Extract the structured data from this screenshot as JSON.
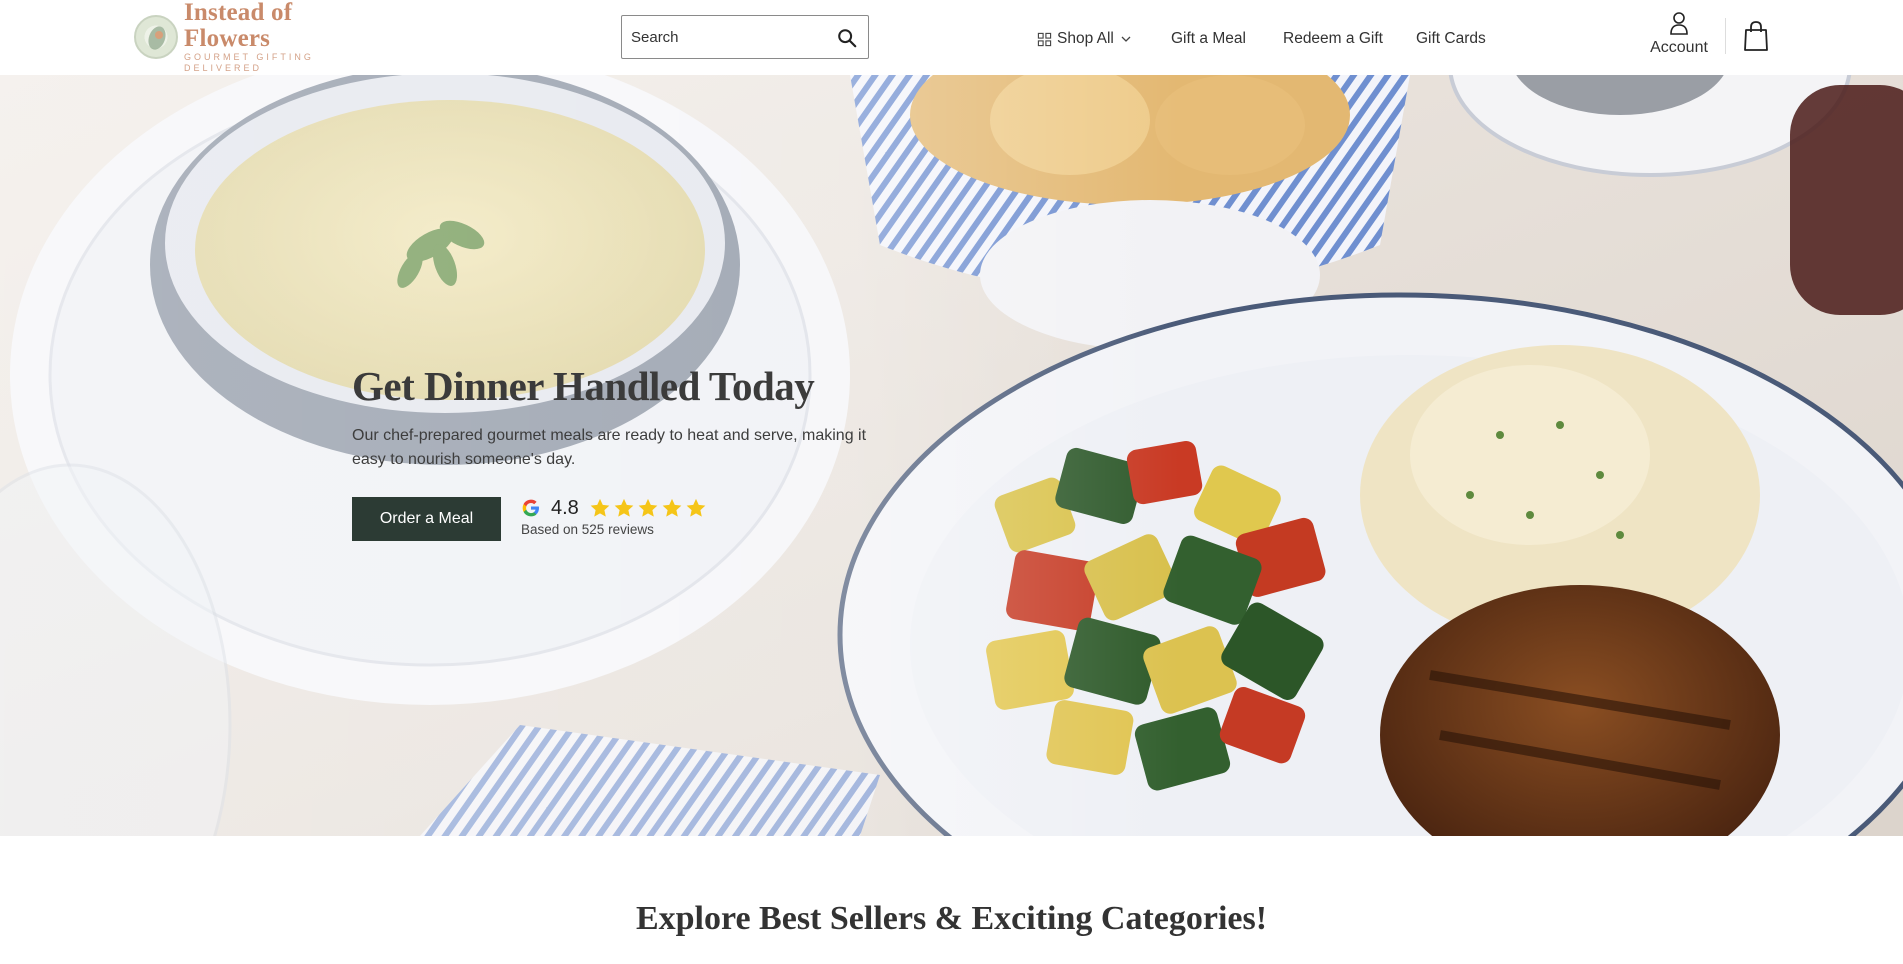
{
  "brand": {
    "name": "Instead of Flowers",
    "tagline": "GOURMET GIFTING DELIVERED",
    "color": "#c98a6a"
  },
  "search": {
    "placeholder": "Search",
    "icon": "search-icon"
  },
  "nav": {
    "items": [
      {
        "label": "Shop All",
        "icon": "grid-icon",
        "has_dropdown": true
      },
      {
        "label": "Gift a Meal"
      },
      {
        "label": "Redeem a Gift"
      },
      {
        "label": "Gift Cards"
      }
    ]
  },
  "account": {
    "label": "Account",
    "icon": "user-icon"
  },
  "cart": {
    "icon": "shopping-bag-icon"
  },
  "hero": {
    "title": "Get Dinner Handled Today",
    "subtitle": "Our chef-prepared gourmet meals are ready to heat and serve, making it easy to nourish someone's day.",
    "cta_label": "Order a Meal",
    "cta_color": "#2c3b34",
    "rating": {
      "source_icon": "google-g-icon",
      "score": "4.8",
      "stars": 5,
      "star_color": "#f5c518",
      "count_text": "Based on 525 reviews"
    }
  },
  "section": {
    "title": "Explore Best Sellers & Exciting Categories!"
  }
}
